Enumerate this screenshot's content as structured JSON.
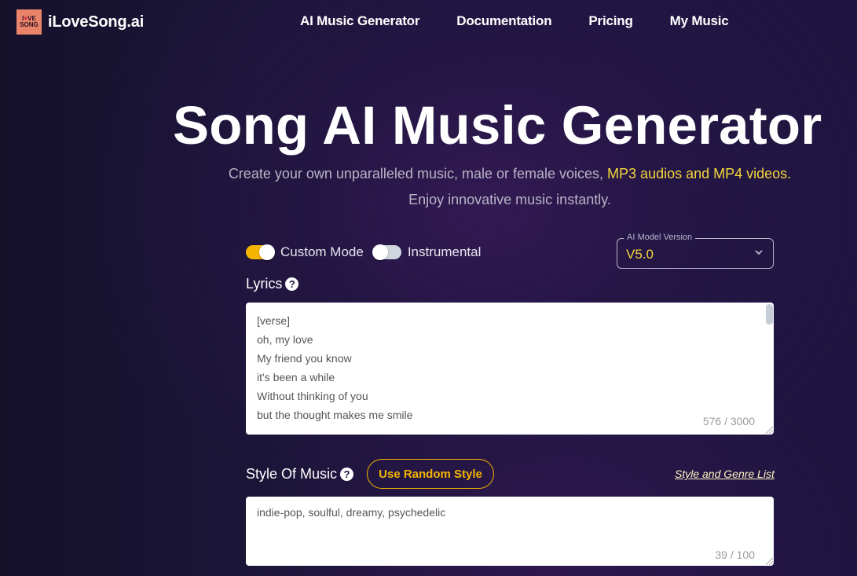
{
  "header": {
    "logo_line1": "I♥VE",
    "logo_line2": "SONG",
    "brand": "iLoveSong.ai",
    "nav": [
      {
        "label": "AI Music Generator"
      },
      {
        "label": "Documentation"
      },
      {
        "label": "Pricing"
      },
      {
        "label": "My Music"
      }
    ]
  },
  "hero": {
    "title": "Song AI Music Generator",
    "subtitle_plain": "Create your own unparalleled music, male or female voices, ",
    "subtitle_highlight": "MP3 audios and MP4 videos.",
    "subtitle2": "Enjoy innovative music instantly."
  },
  "form": {
    "custom_mode": {
      "label": "Custom Mode",
      "on": true
    },
    "instrumental": {
      "label": "Instrumental",
      "on": false
    },
    "model_version": {
      "label": "AI Model Version",
      "value": "V5.0"
    },
    "lyrics": {
      "label": "Lyrics",
      "lines": [
        "[verse]",
        "oh, my love",
        "My friend you know",
        "it's been a while",
        "Without thinking of you",
        "but the thought makes me smile"
      ],
      "counter": "576 / 3000"
    },
    "style": {
      "label": "Style Of Music",
      "random_button": "Use Random Style",
      "genre_link": "Style and Genre List",
      "value": "indie-pop, soulful, dreamy, psychedelic",
      "counter": "39 / 100"
    }
  },
  "colors": {
    "accent_yellow": "#f4b400",
    "highlight_text": "#f5d73b",
    "logo_bg": "#e9836a"
  }
}
